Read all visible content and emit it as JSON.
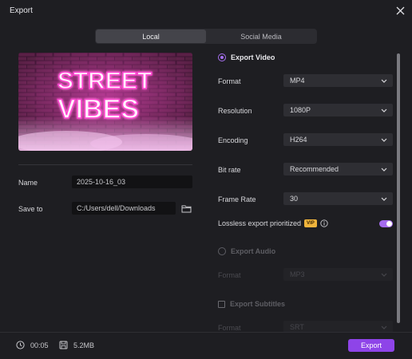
{
  "window": {
    "title": "Export"
  },
  "tabs": [
    {
      "label": "Local",
      "active": true
    },
    {
      "label": "Social Media",
      "active": false
    }
  ],
  "preview": {
    "image_text_line1": "STREET",
    "image_text_line2": "VIBES"
  },
  "fields": {
    "name_label": "Name",
    "name_value": "2025-10-16_03",
    "save_label": "Save to",
    "save_value": "C:/Users/dell/Downloads"
  },
  "export_video": {
    "title": "Export Video",
    "selected": true,
    "format": {
      "label": "Format",
      "value": "MP4"
    },
    "resolution": {
      "label": "Resolution",
      "value": "1080P"
    },
    "encoding": {
      "label": "Encoding",
      "value": "H264"
    },
    "bitrate": {
      "label": "Bit rate",
      "value": "Recommended"
    },
    "framerate": {
      "label": "Frame Rate",
      "value": "30"
    },
    "lossless": {
      "label": "Lossless export prioritized",
      "badge": "VIP",
      "enabled": true
    }
  },
  "export_audio": {
    "title": "Export Audio",
    "selected": false,
    "format": {
      "label": "Format",
      "value": "MP3"
    }
  },
  "export_subtitles": {
    "title": "Export Subtitles",
    "checked": false,
    "format": {
      "label": "Format",
      "value": "SRT"
    }
  },
  "footer": {
    "duration": "00:05",
    "size": "5.2MB",
    "export_label": "Export"
  },
  "colors": {
    "accent": "#a56bf0",
    "export_button": "#8e44e8",
    "background": "#1e1e22",
    "vip_badge": "#f0b43c"
  }
}
